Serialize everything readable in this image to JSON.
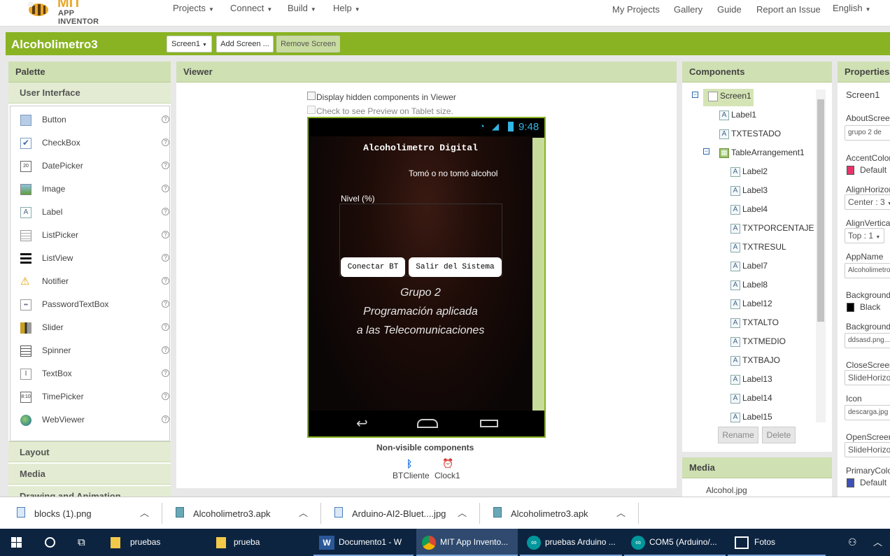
{
  "app": {
    "logo_title": "MIT",
    "logo_subtitle": "APP INVENTOR"
  },
  "topmenu": {
    "projects": "Projects",
    "connect": "Connect",
    "build": "Build",
    "help": "Help",
    "my_projects": "My Projects",
    "gallery": "Gallery",
    "guide": "Guide",
    "report": "Report an Issue",
    "language": "English"
  },
  "project": {
    "name": "Alcoholimetro3",
    "screen_select": "Screen1",
    "add_screen": "Add Screen ...",
    "remove_screen": "Remove Screen"
  },
  "palette": {
    "title": "Palette",
    "section": "User Interface",
    "items": [
      {
        "label": "Button",
        "icon": "button-icon"
      },
      {
        "label": "CheckBox",
        "icon": "checkbox-icon"
      },
      {
        "label": "DatePicker",
        "icon": "datepicker-icon"
      },
      {
        "label": "Image",
        "icon": "image-icon"
      },
      {
        "label": "Label",
        "icon": "label-icon"
      },
      {
        "label": "ListPicker",
        "icon": "listpicker-icon"
      },
      {
        "label": "ListView",
        "icon": "listview-icon"
      },
      {
        "label": "Notifier",
        "icon": "notifier-icon"
      },
      {
        "label": "PasswordTextBox",
        "icon": "password-icon"
      },
      {
        "label": "Slider",
        "icon": "slider-icon"
      },
      {
        "label": "Spinner",
        "icon": "spinner-icon"
      },
      {
        "label": "TextBox",
        "icon": "textbox-icon"
      },
      {
        "label": "TimePicker",
        "icon": "timepicker-icon"
      },
      {
        "label": "WebViewer",
        "icon": "webviewer-icon"
      }
    ],
    "help_glyph": "?",
    "layout": "Layout",
    "media": "Media",
    "drawing": "Drawing and Animation"
  },
  "viewer": {
    "title": "Viewer",
    "hidden_label": "Display hidden components in Viewer",
    "tablet_label": "Check to see Preview on Tablet size.",
    "nonvisible_title": "Non-visible components",
    "nonvisible": [
      "BTCliente",
      "Clock1"
    ]
  },
  "phone": {
    "time": "9:48",
    "title": "Alcoholimetro Digital",
    "status": "Tomó o no tomó alcohol",
    "level": "Nivel (%)",
    "btn_connect": "Conectar BT",
    "btn_exit": "Salir del Sistema",
    "credits": [
      "Grupo 2",
      "Programación aplicada",
      "a las Telecomunicaciones"
    ]
  },
  "components": {
    "title": "Components",
    "tree": [
      {
        "label": "Screen1",
        "level": 0
      },
      {
        "label": "Label1",
        "level": 1
      },
      {
        "label": "TXTESTADO",
        "level": 1
      },
      {
        "label": "TableArrangement1",
        "level": 1
      },
      {
        "label": "Label2",
        "level": 2
      },
      {
        "label": "Label3",
        "level": 2
      },
      {
        "label": "Label4",
        "level": 2
      },
      {
        "label": "TXTPORCENTAJE",
        "level": 2
      },
      {
        "label": "TXTRESUL",
        "level": 2
      },
      {
        "label": "Label7",
        "level": 2
      },
      {
        "label": "Label8",
        "level": 2
      },
      {
        "label": "Label12",
        "level": 2
      },
      {
        "label": "TXTALTO",
        "level": 2
      },
      {
        "label": "TXTMEDIO",
        "level": 2
      },
      {
        "label": "TXTBAJO",
        "level": 2
      },
      {
        "label": "Label13",
        "level": 2
      },
      {
        "label": "Label14",
        "level": 2
      },
      {
        "label": "Label15",
        "level": 2
      }
    ],
    "rename": "Rename",
    "delete": "Delete"
  },
  "media": {
    "title": "Media",
    "first": "Alcohol.jpg"
  },
  "properties": {
    "title": "Properties",
    "screen": "Screen1",
    "about_label": "AboutScreen",
    "about_value": "grupo 2 de",
    "accent_label": "AccentColor",
    "accent_value": "Default",
    "accent_color": "#e8336a",
    "alignh_label": "AlignHorizontal",
    "alignh_value": "Center : 3",
    "alignv_label": "AlignVertical",
    "alignv_value": "Top : 1",
    "appname_label": "AppName",
    "appname_value": "Alcoholimetro",
    "bgcolor_label": "BackgroundColor",
    "bgcolor_value": "Black",
    "bgcolor_color": "#000000",
    "bgimage_label": "BackgroundImage",
    "bgimage_value": "ddsasd.png...",
    "close_label": "CloseScreenAnimation",
    "close_value": "SlideHorizontal",
    "icon_label": "Icon",
    "icon_value": "descarga.jpg",
    "open_label": "OpenScreenAnimation",
    "open_value": "SlideHorizontal",
    "primary_label": "PrimaryColor",
    "primary_value": "Default",
    "primary_color": "#3f51b5"
  },
  "downloads": [
    "blocks (1).png",
    "Alcoholimetro3.apk",
    "Arduino-AI2-Bluet....jpg",
    "Alcoholimetro3.apk"
  ],
  "taskbar": [
    "pruebas",
    "prueba",
    "Documento1 - W",
    "MIT App Invento...",
    "pruebas Arduino ...",
    "COM5 (Arduino/...",
    "Fotos"
  ]
}
